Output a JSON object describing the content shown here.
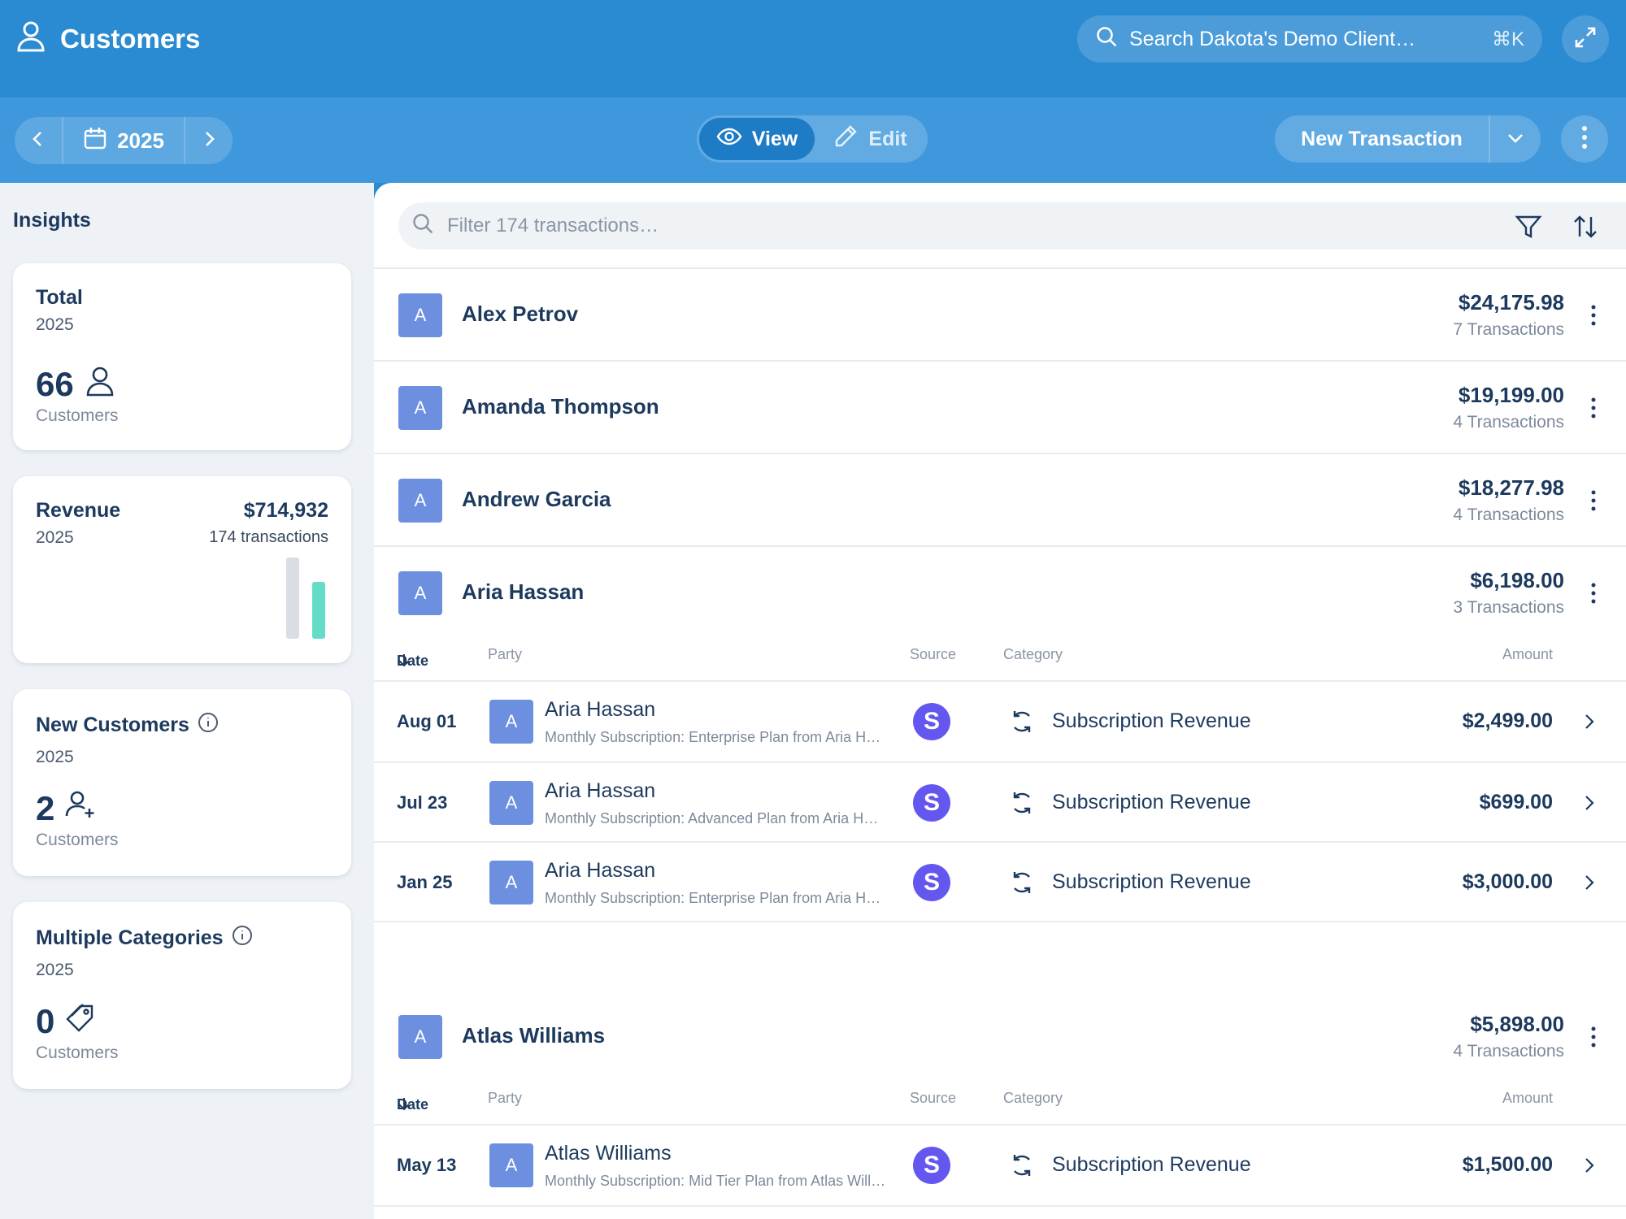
{
  "header": {
    "title": "Customers",
    "search_placeholder": "Search Dakota's Demo Client…",
    "search_shortcut": "⌘K"
  },
  "toolbar": {
    "year": "2025",
    "view_label": "View",
    "edit_label": "Edit",
    "new_transaction_label": "New Transaction"
  },
  "sidebar": {
    "heading": "Insights",
    "cards": [
      {
        "title": "Total",
        "year": "2025",
        "value": "66",
        "unit": "Customers"
      },
      {
        "title": "Revenue",
        "year": "2025",
        "value": "$714,932",
        "sub": "174 transactions"
      },
      {
        "title": "New Customers",
        "year": "2025",
        "value": "2",
        "unit": "Customers"
      },
      {
        "title": "Multiple Categories",
        "year": "2025",
        "value": "0",
        "unit": "Customers"
      }
    ]
  },
  "main": {
    "filter_placeholder": "Filter 174 transactions…",
    "table_headers": {
      "date": "Date",
      "party": "Party",
      "source": "Source",
      "category": "Category",
      "amount": "Amount"
    },
    "customers": [
      {
        "initial": "A",
        "name": "Alex Petrov",
        "amount": "$24,175.98",
        "count": "7 Transactions"
      },
      {
        "initial": "A",
        "name": "Amanda Thompson",
        "amount": "$19,199.00",
        "count": "4 Transactions"
      },
      {
        "initial": "A",
        "name": "Andrew Garcia",
        "amount": "$18,277.98",
        "count": "4 Transactions"
      },
      {
        "initial": "A",
        "name": "Aria Hassan",
        "amount": "$6,198.00",
        "count": "3 Transactions"
      },
      {
        "initial": "A",
        "name": "Atlas Williams",
        "amount": "$5,898.00",
        "count": "4 Transactions"
      }
    ],
    "aria_transactions": [
      {
        "date": "Aug 01",
        "initial": "A",
        "party": "Aria Hassan",
        "memo": "Monthly Subscription: Enterprise Plan from Aria Hassan",
        "source": "S",
        "category": "Subscription Revenue",
        "amount": "$2,499.00"
      },
      {
        "date": "Jul 23",
        "initial": "A",
        "party": "Aria Hassan",
        "memo": "Monthly Subscription: Advanced Plan from Aria Hassan",
        "source": "S",
        "category": "Subscription Revenue",
        "amount": "$699.00"
      },
      {
        "date": "Jan 25",
        "initial": "A",
        "party": "Aria Hassan",
        "memo": "Monthly Subscription: Enterprise Plan from Aria Hassan",
        "source": "S",
        "category": "Subscription Revenue",
        "amount": "$3,000.00"
      }
    ],
    "atlas_transactions": [
      {
        "date": "May 13",
        "initial": "A",
        "party": "Atlas Williams",
        "memo": "Monthly Subscription: Mid Tier Plan from Atlas Williams",
        "source": "S",
        "category": "Subscription Revenue",
        "amount": "$1,500.00"
      }
    ]
  },
  "colors": {
    "header_bg": "#2a8ad2",
    "toolbar_bg": "#3f98dc",
    "avatar": "#6d8fe0",
    "source_badge": "#6457f0",
    "revenue_bar": "#64dcc8"
  }
}
